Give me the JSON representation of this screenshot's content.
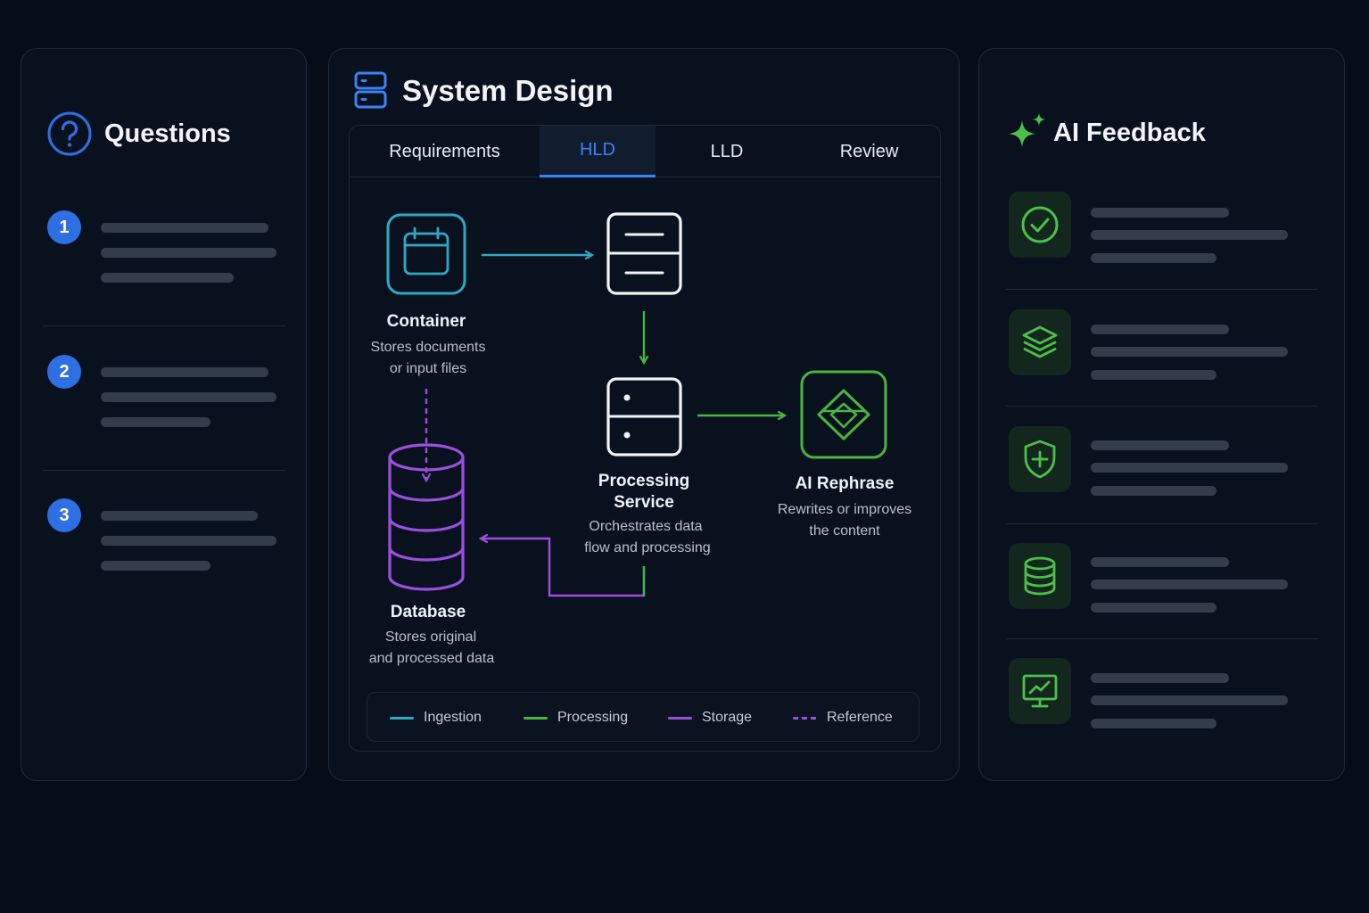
{
  "questions": {
    "title": "Questions",
    "items": [
      {
        "number": "1"
      },
      {
        "number": "2"
      },
      {
        "number": "3"
      }
    ]
  },
  "design": {
    "title": "System Design",
    "tabs": [
      {
        "label": "Requirements"
      },
      {
        "label": "HLD"
      },
      {
        "label": "LLD"
      },
      {
        "label": "Review"
      }
    ],
    "active_tab": "HLD",
    "nodes": {
      "container": {
        "label": "Container",
        "desc_line1": "Stores documents",
        "desc_line2": "or input files"
      },
      "processing": {
        "label_line1": "Processing",
        "label_line2": "Service",
        "desc_line1": "Orchestrates data",
        "desc_line2": "flow and processing"
      },
      "ai": {
        "label": "AI Rephrase",
        "desc_line1": "Rewrites or improves",
        "desc_line2": "the content"
      },
      "database": {
        "label": "Database",
        "desc_line1": "Stores original",
        "desc_line2": "and processed data"
      }
    },
    "legend": [
      {
        "label": "Ingestion",
        "color": "#2fa8c6",
        "dashed": false
      },
      {
        "label": "Processing",
        "color": "#46b63f",
        "dashed": false
      },
      {
        "label": "Storage",
        "color": "#9b4fe0",
        "dashed": false
      },
      {
        "label": "Reference",
        "color": "#9b4fe0",
        "dashed": true
      }
    ]
  },
  "feedback": {
    "title": "AI Feedback",
    "items": [
      {
        "icon": "check-circle-icon"
      },
      {
        "icon": "layers-icon"
      },
      {
        "icon": "shield-plus-icon"
      },
      {
        "icon": "database-icon"
      },
      {
        "icon": "monitor-chart-icon"
      }
    ]
  },
  "colors": {
    "accent_blue": "#3b82f6",
    "ingestion": "#2fa8c6",
    "processing": "#46b63f",
    "storage": "#9b4fe0",
    "feedback_green": "#4cc14a"
  }
}
